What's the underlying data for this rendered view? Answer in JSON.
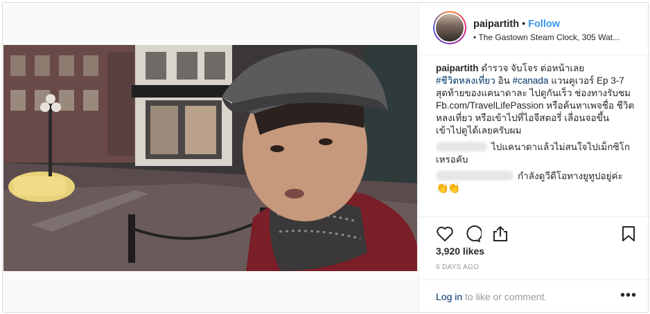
{
  "header": {
    "username": "paipartith",
    "dot": "•",
    "follow_label": "Follow",
    "location": "• The Gastown Steam Clock, 305 Wat..."
  },
  "caption": {
    "username": "paipartith",
    "text_1": " ตำรวจ จับโจร ต่อหน้าเลย",
    "hashtag_1": "#ชีวิตหลงเที่ยว",
    "text_2": " อิน ",
    "hashtag_2": "#canada",
    "text_3": " แวนคูเวอร์ Ep 3-7 สุดท้ายของแคนาดาละ ไปดูกันเร็ว ช่องทางรับชม Fb.com/TravelLifePassion หรือค้นหาเพจชื่อ ชีวิตหลงเที่ยว หรือเข้าไปที่ไอจีสตอรี่ เลื่อนจอขึ้น เข้าไปดูได้เลยครับผม"
  },
  "comments": [
    {
      "text": "ไปแคนาดาแล้วไม่สนใจไปเม็กซิโกเหรอคับ"
    },
    {
      "text": "กำลังดูวีดีโอทางยูทูปอยู่ค่ะ",
      "emoji": "👏👏"
    }
  ],
  "actions": {
    "like_icon": "heart-icon",
    "comment_icon": "comment-icon",
    "share_icon": "share-icon",
    "save_icon": "bookmark-icon"
  },
  "likes": "3,920 likes",
  "time_ago": "6 days ago",
  "footer": {
    "login_label": "Log in",
    "login_suffix": " to like or comment.",
    "more_label": "•••"
  },
  "colors": {
    "link_blue": "#3897f0",
    "hashtag": "#003569",
    "muted": "#999999",
    "border": "#efefef"
  }
}
